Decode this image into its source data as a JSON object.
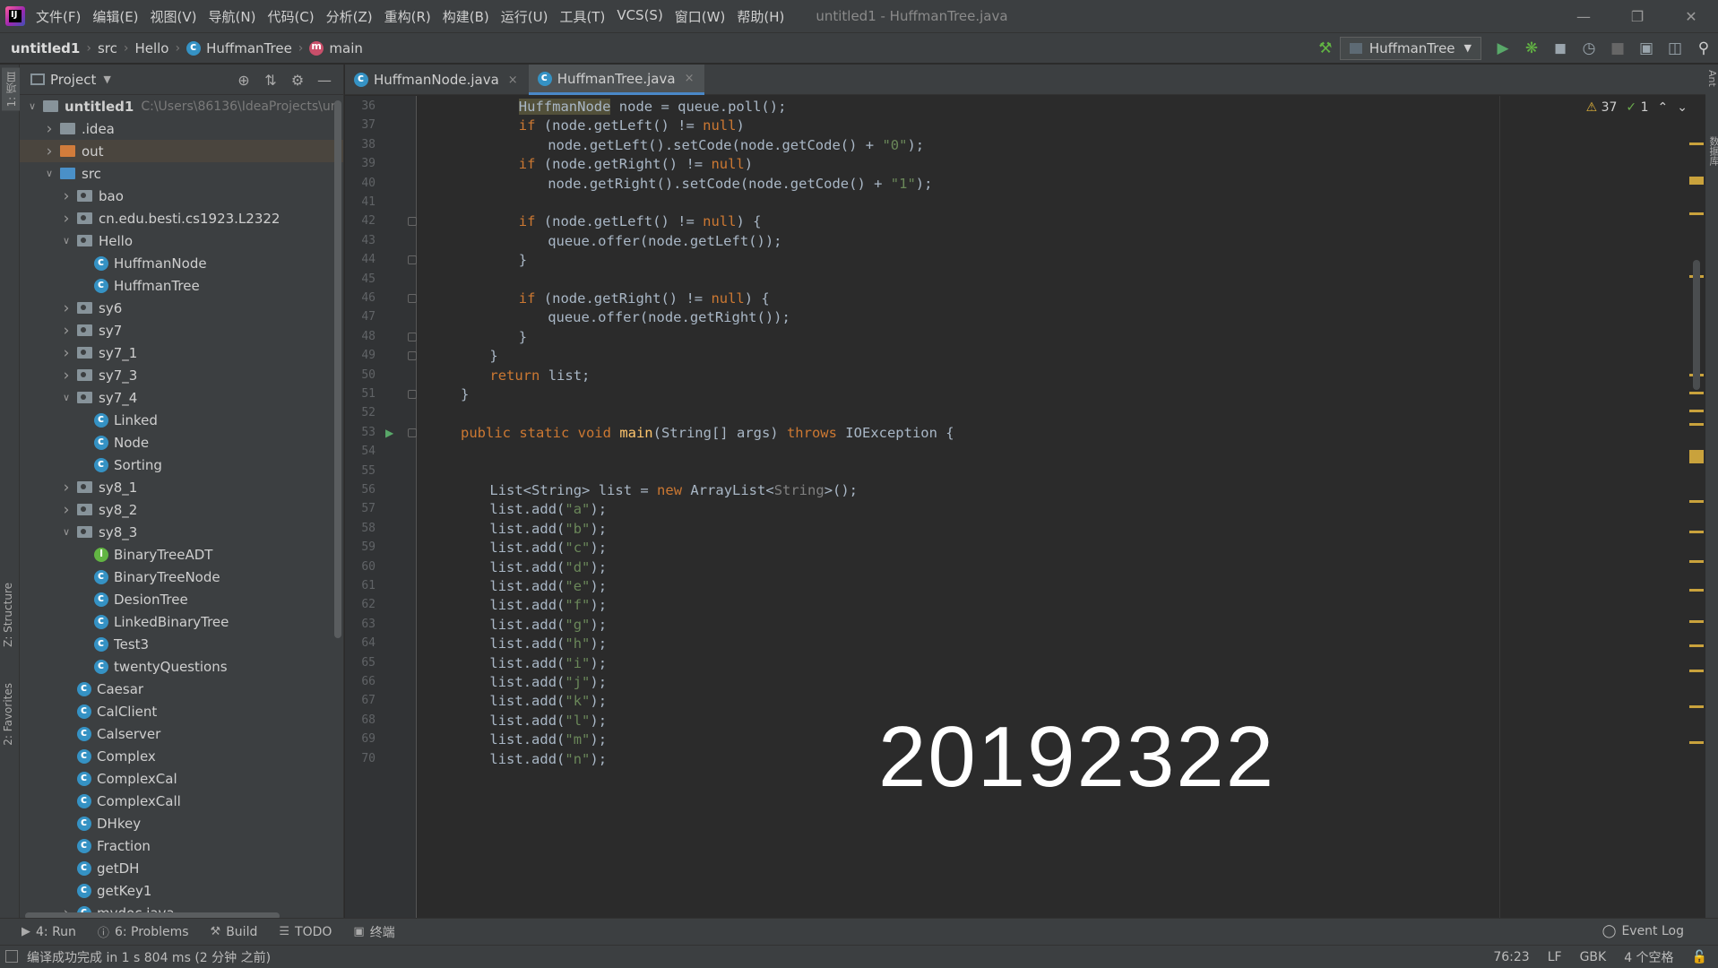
{
  "window": {
    "logo_text": "IJ",
    "title": "untitled1 - HuffmanTree.java",
    "menu": [
      "文件(F)",
      "编辑(E)",
      "视图(V)",
      "导航(N)",
      "代码(C)",
      "分析(Z)",
      "重构(R)",
      "构建(B)",
      "运行(U)",
      "工具(T)",
      "VCS(S)",
      "窗口(W)",
      "帮助(H)"
    ]
  },
  "breadcrumb": [
    "untitled1",
    "src",
    "Hello",
    "HuffmanTree",
    "main"
  ],
  "toolbar": {
    "run_config": "HuffmanTree"
  },
  "left_stripe": {
    "project_tab": "1: 项目",
    "structure_tab": "Z: Structure",
    "favorites_tab": "2: Favorites"
  },
  "right_stripe": {
    "ant_tab": "Ant",
    "db_tab": "数据库"
  },
  "project_panel": {
    "title": "Project",
    "tree": [
      {
        "label": "untitled1",
        "hint": "C:\\Users\\86136\\IdeaProjects\\un",
        "depth": 0,
        "arrow": "down",
        "icon": "project-folder"
      },
      {
        "label": ".idea",
        "depth": 1,
        "arrow": "right",
        "icon": "folder"
      },
      {
        "label": "out",
        "depth": 1,
        "arrow": "right",
        "icon": "excluded-folder"
      },
      {
        "label": "src",
        "depth": 1,
        "arrow": "down",
        "icon": "source-folder"
      },
      {
        "label": "bao",
        "depth": 2,
        "arrow": "right",
        "icon": "package"
      },
      {
        "label": "cn.edu.besti.cs1923.L2322",
        "depth": 2,
        "arrow": "right",
        "icon": "package"
      },
      {
        "label": "Hello",
        "depth": 2,
        "arrow": "down",
        "icon": "package"
      },
      {
        "label": "HuffmanNode",
        "depth": 3,
        "icon": "class"
      },
      {
        "label": "HuffmanTree",
        "depth": 3,
        "icon": "class"
      },
      {
        "label": "sy6",
        "depth": 2,
        "arrow": "right",
        "icon": "package"
      },
      {
        "label": "sy7",
        "depth": 2,
        "arrow": "right",
        "icon": "package"
      },
      {
        "label": "sy7_1",
        "depth": 2,
        "arrow": "right",
        "icon": "package"
      },
      {
        "label": "sy7_3",
        "depth": 2,
        "arrow": "right",
        "icon": "package"
      },
      {
        "label": "sy7_4",
        "depth": 2,
        "arrow": "down",
        "icon": "package"
      },
      {
        "label": "Linked",
        "depth": 3,
        "icon": "class"
      },
      {
        "label": "Node",
        "depth": 3,
        "icon": "class"
      },
      {
        "label": "Sorting",
        "depth": 3,
        "icon": "class"
      },
      {
        "label": "sy8_1",
        "depth": 2,
        "arrow": "right",
        "icon": "package"
      },
      {
        "label": "sy8_2",
        "depth": 2,
        "arrow": "right",
        "icon": "package"
      },
      {
        "label": "sy8_3",
        "depth": 2,
        "arrow": "down",
        "icon": "package"
      },
      {
        "label": "BinaryTreeADT",
        "depth": 3,
        "icon": "interface"
      },
      {
        "label": "BinaryTreeNode",
        "depth": 3,
        "icon": "class"
      },
      {
        "label": "DesionTree",
        "depth": 3,
        "icon": "class"
      },
      {
        "label": "LinkedBinaryTree",
        "depth": 3,
        "icon": "class"
      },
      {
        "label": "Test3",
        "depth": 3,
        "icon": "class"
      },
      {
        "label": "twentyQuestions",
        "depth": 3,
        "icon": "class"
      },
      {
        "label": "Caesar",
        "depth": 2,
        "icon": "class"
      },
      {
        "label": "CalClient",
        "depth": 2,
        "icon": "class"
      },
      {
        "label": "Calserver",
        "depth": 2,
        "icon": "class"
      },
      {
        "label": "Complex",
        "depth": 2,
        "icon": "class"
      },
      {
        "label": "ComplexCal",
        "depth": 2,
        "icon": "class"
      },
      {
        "label": "ComplexCall",
        "depth": 2,
        "icon": "class"
      },
      {
        "label": "DHkey",
        "depth": 2,
        "icon": "class"
      },
      {
        "label": "Fraction",
        "depth": 2,
        "icon": "class"
      },
      {
        "label": "getDH",
        "depth": 2,
        "icon": "class"
      },
      {
        "label": "getKey1",
        "depth": 2,
        "icon": "class"
      },
      {
        "label": "mydoc.java",
        "depth": 2,
        "arrow": "right",
        "icon": "class"
      }
    ]
  },
  "editor_tabs": [
    {
      "label": "HuffmanNode.java",
      "active": false
    },
    {
      "label": "HuffmanTree.java",
      "active": true
    }
  ],
  "code_lines": [
    {
      "n": "36",
      "indent": 8,
      "tokens": [
        [
          "HuffmanNode",
          "hl"
        ],
        [
          " node = queue.poll();",
          ""
        ]
      ]
    },
    {
      "n": "37",
      "indent": 8,
      "tokens": [
        [
          "if",
          "kw"
        ],
        [
          " (node.getLeft() != ",
          ""
        ],
        [
          "null",
          "kw"
        ],
        [
          ")",
          ""
        ]
      ]
    },
    {
      "n": "38",
      "indent": 12,
      "tokens": [
        [
          "node.getLeft().setCode(node.getCode() + ",
          ""
        ],
        [
          "\"0\"",
          "str"
        ],
        [
          ");",
          ""
        ]
      ]
    },
    {
      "n": "39",
      "indent": 8,
      "tokens": [
        [
          "if",
          "kw"
        ],
        [
          " (node.getRight() != ",
          ""
        ],
        [
          "null",
          "kw"
        ],
        [
          ")",
          ""
        ]
      ]
    },
    {
      "n": "40",
      "indent": 12,
      "tokens": [
        [
          "node.getRight().setCode(node.getCode() + ",
          ""
        ],
        [
          "\"1\"",
          "str"
        ],
        [
          ");",
          ""
        ]
      ]
    },
    {
      "n": "41",
      "indent": 0,
      "tokens": []
    },
    {
      "n": "42",
      "indent": 8,
      "tokens": [
        [
          "if",
          "kw"
        ],
        [
          " (node.getLeft() != ",
          ""
        ],
        [
          "null",
          "kw"
        ],
        [
          ") {",
          ""
        ]
      ]
    },
    {
      "n": "43",
      "indent": 12,
      "tokens": [
        [
          "queue.offer(node.getLeft());",
          ""
        ]
      ]
    },
    {
      "n": "44",
      "indent": 8,
      "tokens": [
        [
          "}",
          ""
        ]
      ]
    },
    {
      "n": "45",
      "indent": 0,
      "tokens": []
    },
    {
      "n": "46",
      "indent": 8,
      "tokens": [
        [
          "if",
          "kw"
        ],
        [
          " (node.getRight() != ",
          ""
        ],
        [
          "null",
          "kw"
        ],
        [
          ") {",
          ""
        ]
      ]
    },
    {
      "n": "47",
      "indent": 12,
      "tokens": [
        [
          "queue.offer(node.getRight());",
          ""
        ]
      ]
    },
    {
      "n": "48",
      "indent": 8,
      "tokens": [
        [
          "}",
          ""
        ]
      ]
    },
    {
      "n": "49",
      "indent": 4,
      "tokens": [
        [
          "}",
          ""
        ]
      ]
    },
    {
      "n": "50",
      "indent": 4,
      "tokens": [
        [
          "return",
          "kw"
        ],
        [
          " list;",
          ""
        ]
      ]
    },
    {
      "n": "51",
      "indent": 0,
      "tokens": [
        [
          "}",
          ""
        ]
      ]
    },
    {
      "n": "52",
      "indent": 0,
      "tokens": []
    },
    {
      "n": "53",
      "indent": 0,
      "tokens": [
        [
          "public static void ",
          "kw"
        ],
        [
          "main",
          "fn"
        ],
        [
          "(String[] args) ",
          ""
        ],
        [
          "throws",
          "kw"
        ],
        [
          " IOException {",
          ""
        ]
      ]
    },
    {
      "n": "54",
      "indent": 0,
      "tokens": []
    },
    {
      "n": "55",
      "indent": 0,
      "tokens": []
    },
    {
      "n": "56",
      "indent": 4,
      "tokens": [
        [
          "List<String> list = ",
          ""
        ],
        [
          "new",
          "kw"
        ],
        [
          " ArrayList<",
          ""
        ],
        [
          "String",
          "gen"
        ],
        [
          ">();",
          ""
        ]
      ]
    },
    {
      "n": "57",
      "indent": 4,
      "tokens": [
        [
          "list.add(",
          ""
        ],
        [
          "\"a\"",
          "str"
        ],
        [
          ");",
          ""
        ]
      ]
    },
    {
      "n": "58",
      "indent": 4,
      "tokens": [
        [
          "list.add(",
          ""
        ],
        [
          "\"b\"",
          "str"
        ],
        [
          ");",
          ""
        ]
      ]
    },
    {
      "n": "59",
      "indent": 4,
      "tokens": [
        [
          "list.add(",
          ""
        ],
        [
          "\"c\"",
          "str"
        ],
        [
          ");",
          ""
        ]
      ]
    },
    {
      "n": "60",
      "indent": 4,
      "tokens": [
        [
          "list.add(",
          ""
        ],
        [
          "\"d\"",
          "str"
        ],
        [
          ");",
          ""
        ]
      ]
    },
    {
      "n": "61",
      "indent": 4,
      "tokens": [
        [
          "list.add(",
          ""
        ],
        [
          "\"e\"",
          "str"
        ],
        [
          ");",
          ""
        ]
      ]
    },
    {
      "n": "62",
      "indent": 4,
      "tokens": [
        [
          "list.add(",
          ""
        ],
        [
          "\"f\"",
          "str"
        ],
        [
          ");",
          ""
        ]
      ]
    },
    {
      "n": "63",
      "indent": 4,
      "tokens": [
        [
          "list.add(",
          ""
        ],
        [
          "\"g\"",
          "str"
        ],
        [
          ");",
          ""
        ]
      ]
    },
    {
      "n": "64",
      "indent": 4,
      "tokens": [
        [
          "list.add(",
          ""
        ],
        [
          "\"h\"",
          "str"
        ],
        [
          ");",
          ""
        ]
      ]
    },
    {
      "n": "65",
      "indent": 4,
      "tokens": [
        [
          "list.add(",
          ""
        ],
        [
          "\"i\"",
          "str"
        ],
        [
          ");",
          ""
        ]
      ]
    },
    {
      "n": "66",
      "indent": 4,
      "tokens": [
        [
          "list.add(",
          ""
        ],
        [
          "\"j\"",
          "str"
        ],
        [
          ");",
          ""
        ]
      ]
    },
    {
      "n": "67",
      "indent": 4,
      "tokens": [
        [
          "list.add(",
          ""
        ],
        [
          "\"k\"",
          "str"
        ],
        [
          ");",
          ""
        ]
      ]
    },
    {
      "n": "68",
      "indent": 4,
      "tokens": [
        [
          "list.add(",
          ""
        ],
        [
          "\"l\"",
          "str"
        ],
        [
          ");",
          ""
        ]
      ]
    },
    {
      "n": "69",
      "indent": 4,
      "tokens": [
        [
          "list.add(",
          ""
        ],
        [
          "\"m\"",
          "str"
        ],
        [
          ");",
          ""
        ]
      ]
    },
    {
      "n": "70",
      "indent": 4,
      "tokens": [
        [
          "list.add(",
          ""
        ],
        [
          "\"n\"",
          "str"
        ],
        [
          ");",
          ""
        ]
      ]
    }
  ],
  "inspections": {
    "warnings": "37",
    "weak_warnings": "1"
  },
  "watermark": "20192322",
  "tool_tabs": [
    {
      "label": "4: Run",
      "icon": "run-icon"
    },
    {
      "label": "6: Problems",
      "icon": "problems-icon"
    },
    {
      "label": "Build",
      "icon": "build-icon"
    },
    {
      "label": "TODO",
      "icon": "todo-icon"
    },
    {
      "label": "终端",
      "icon": "terminal-icon"
    }
  ],
  "event_log": "Event Log",
  "status": {
    "message": "编译成功完成 in 1 s 804 ms (2 分钟 之前)",
    "position": "76:23",
    "line_sep": "LF",
    "encoding": "GBK",
    "indent": "4 个空格"
  },
  "colors": {
    "accent": "#4a88c7",
    "keyword": "#cc7832",
    "string": "#6a8759",
    "function": "#ffc66d",
    "warning": "#e0b23a"
  }
}
